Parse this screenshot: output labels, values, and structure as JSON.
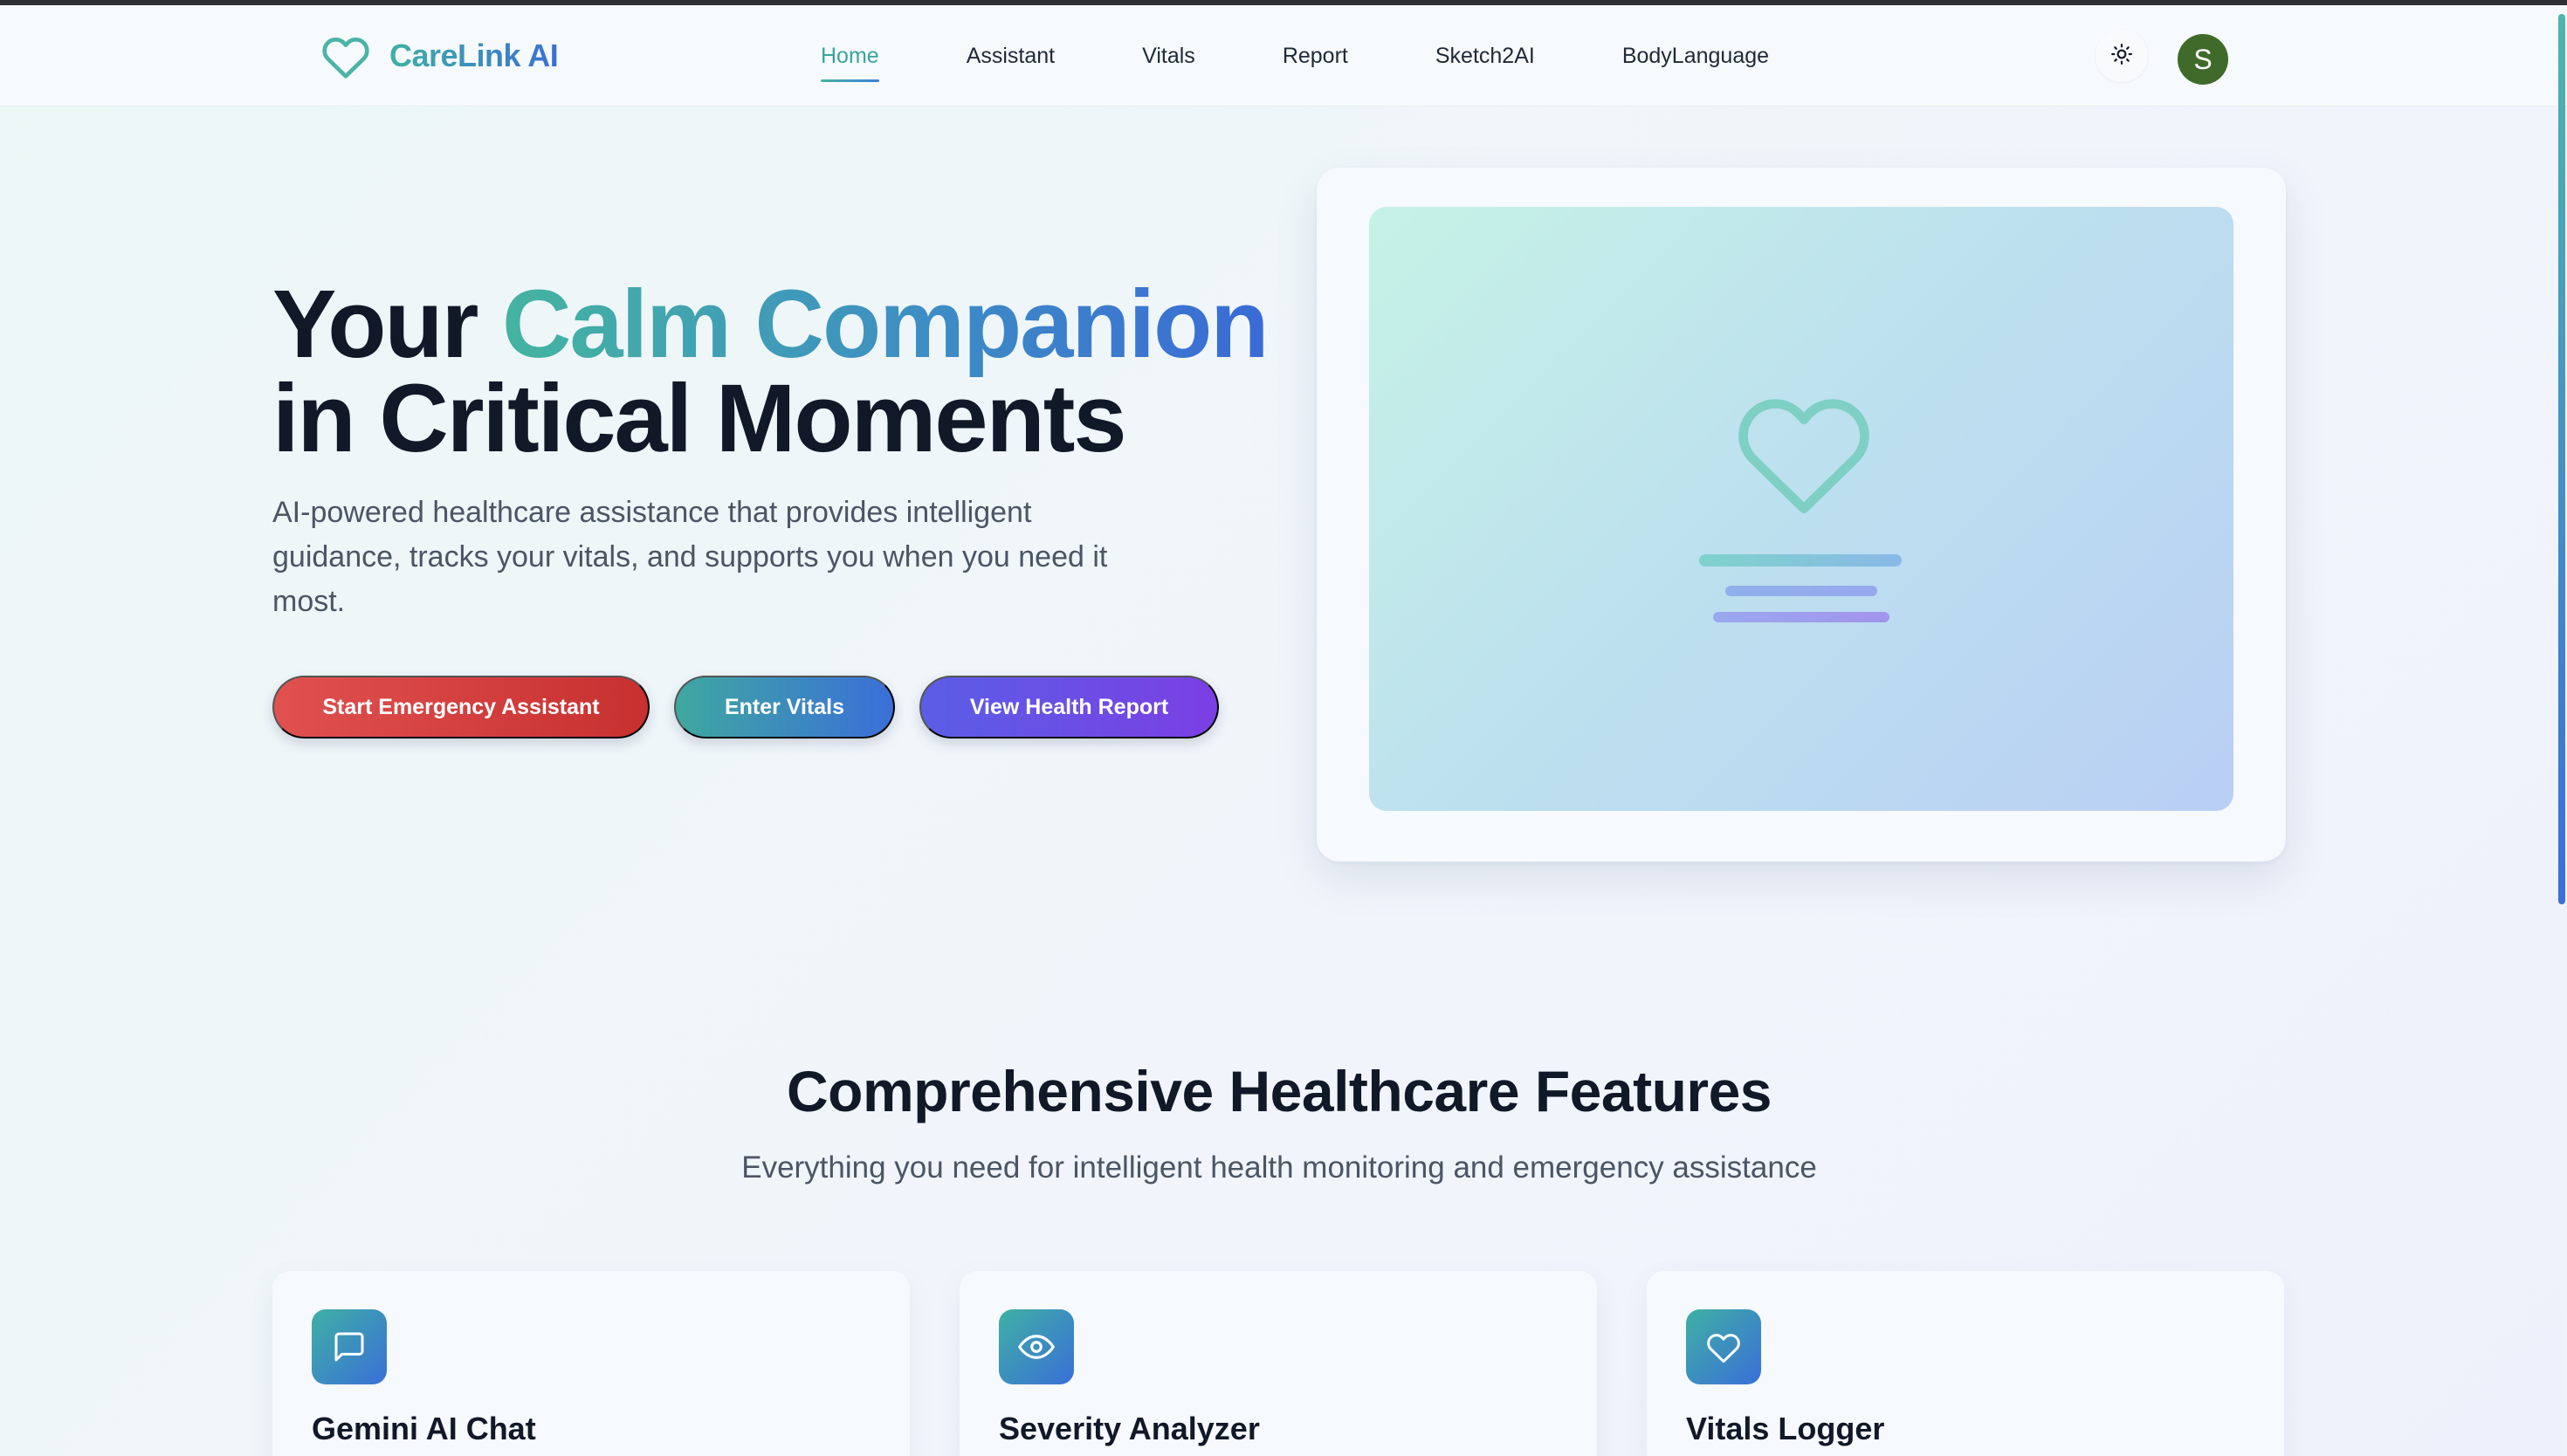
{
  "app": {
    "name": "CareLink AI"
  },
  "nav": {
    "items": [
      {
        "label": "Home",
        "active": true
      },
      {
        "label": "Assistant",
        "active": false
      },
      {
        "label": "Vitals",
        "active": false
      },
      {
        "label": "Report",
        "active": false
      },
      {
        "label": "Sketch2AI",
        "active": false
      },
      {
        "label": "BodyLanguage",
        "active": false
      }
    ],
    "theme_icon": "sun-icon",
    "avatar_initial": "S"
  },
  "hero": {
    "title_plain_1": "Your ",
    "title_accent": "Calm Companion",
    "title_plain_2": "in Critical Moments",
    "subtitle": "AI-powered healthcare assistance that provides intelligent guidance, tracks your vitals, and supports you when you need it most.",
    "buttons": {
      "emergency": "Start Emergency Assistant",
      "vitals": "Enter Vitals",
      "report": "View Health Report"
    },
    "illustration_icon": "heart-icon"
  },
  "features": {
    "title": "Comprehensive Healthcare Features",
    "subtitle": "Everything you need for intelligent health monitoring and emergency assistance",
    "cards": [
      {
        "title": "Gemini AI Chat",
        "icon": "chat-bubble-icon"
      },
      {
        "title": "Severity Analyzer",
        "icon": "eye-icon"
      },
      {
        "title": "Vitals Logger",
        "icon": "heart-icon"
      }
    ]
  },
  "colors": {
    "primary_teal": "#3fb0a4",
    "primary_blue": "#3a6fd8",
    "emergency_red": "#d83f3e",
    "report_purple": "#6a4fe5",
    "avatar_green": "#3f6a2a"
  }
}
